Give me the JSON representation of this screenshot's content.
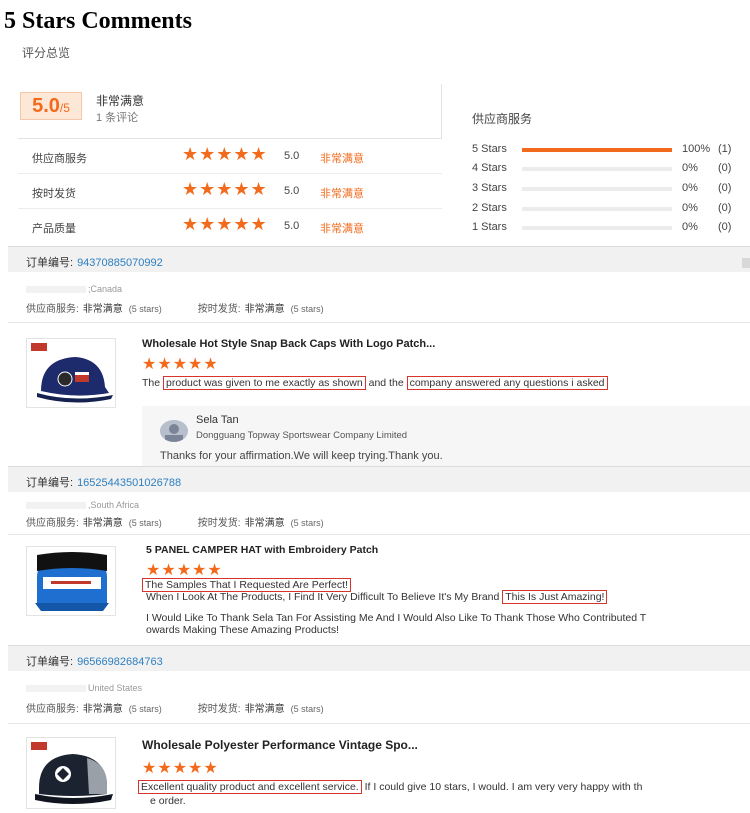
{
  "page": {
    "title": "5 Stars Comments",
    "overview_label": "评分总览"
  },
  "summary": {
    "score": "5.0",
    "score_out_of": "/5",
    "verdict": "非常满意",
    "review_count": "1 条评论",
    "rows": [
      {
        "label": "供应商服务",
        "stars": "★★★★★",
        "value": "5.0",
        "verdict": "非常满意"
      },
      {
        "label": "按时发货",
        "stars": "★★★★★",
        "value": "5.0",
        "verdict": "非常满意"
      },
      {
        "label": "产品质量",
        "stars": "★★★★★",
        "value": "5.0",
        "verdict": "非常满意"
      }
    ]
  },
  "distribution": {
    "title": "供应商服务",
    "rows": [
      {
        "label": "5 Stars",
        "percent": "100%",
        "count": "(1)",
        "fill_fraction": 1.0
      },
      {
        "label": "4 Stars",
        "percent": "0%",
        "count": "(0)",
        "fill_fraction": 0.0
      },
      {
        "label": "3 Stars",
        "percent": "0%",
        "count": "(0)",
        "fill_fraction": 0.0
      },
      {
        "label": "2 Stars",
        "percent": "0%",
        "count": "(0)",
        "fill_fraction": 0.0
      },
      {
        "label": "1 Stars",
        "percent": "0%",
        "count": "(0)",
        "fill_fraction": 0.0
      }
    ]
  },
  "order_label": "订单编号:",
  "rating_labels": {
    "service": "供应商服务:",
    "delivery": "按时发货:",
    "verdict": "非常满意",
    "stars_text": "(5 stars)"
  },
  "orders": [
    {
      "order_number": "94370885070992",
      "country": ";Canada",
      "product_title": "Wholesale Hot Style Snap Back Caps With Logo Patch...",
      "stars": "★★★★★",
      "comment": {
        "p1": "The ",
        "h1": "product was given to me exactly as shown",
        "p2": " and the ",
        "h2": "company answered any questions i asked"
      },
      "reply": {
        "name": "Sela Tan",
        "company": "Dongguang Topway Sportswear Company Limited",
        "text": "Thanks for your affirmation.We will keep trying.Thank you."
      }
    },
    {
      "order_number": "16525443501026788",
      "country": ",South Africa",
      "product_title": "5 PANEL CAMPER HAT with Embroidery Patch",
      "stars": "★★★★★",
      "comment": {
        "h1": "The Samples That I Requested Are Perfect!",
        "p1": "When I Look At The Products, I Find It Very Difficult To Believe It's My Brand ",
        "h2": "This Is Just Amazing!",
        "p2": "I Would Like To Thank Sela Tan For Assisting Me And I Would Also Like To Thank Those Who Contributed T",
        "p3": "owards Making These Amazing Products!"
      }
    },
    {
      "order_number": "96566982684763",
      "country": "United States",
      "product_title": "Wholesale Polyester Performance Vintage Spo...",
      "stars": "★★★★★",
      "comment": {
        "h1": "Excellent quality product and excellent service.",
        "p1": " If I could give 10 stars, I would. I am very very happy with th",
        "p2": "e order."
      }
    }
  ],
  "colors": {
    "accent": "#f26b1d",
    "link": "#2d7fc1",
    "highlight_border": "#d6352c"
  }
}
